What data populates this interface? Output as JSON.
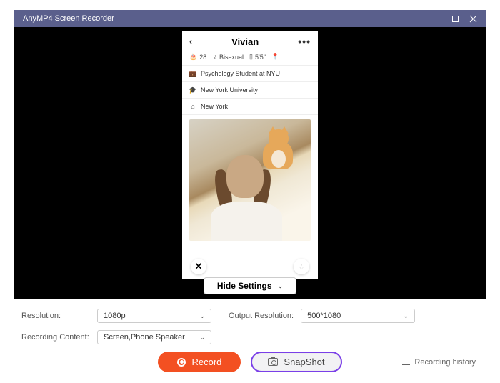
{
  "titlebar": {
    "title": "AnyMP4 Screen Recorder"
  },
  "phone": {
    "name": "Vivian",
    "age": "28",
    "orientation": "Bisexual",
    "height": "5'5\"",
    "occupation": "Psychology Student at NYU",
    "school": "New York University",
    "city": "New York"
  },
  "hide_settings": {
    "label": "Hide Settings"
  },
  "settings": {
    "resolution_label": "Resolution:",
    "resolution_value": "1080p",
    "output_resolution_label": "Output Resolution:",
    "output_resolution_value": "500*1080",
    "recording_content_label": "Recording Content:",
    "recording_content_value": "Screen,Phone Speaker"
  },
  "buttons": {
    "record": "Record",
    "snapshot": "SnapShot",
    "history": "Recording history"
  }
}
